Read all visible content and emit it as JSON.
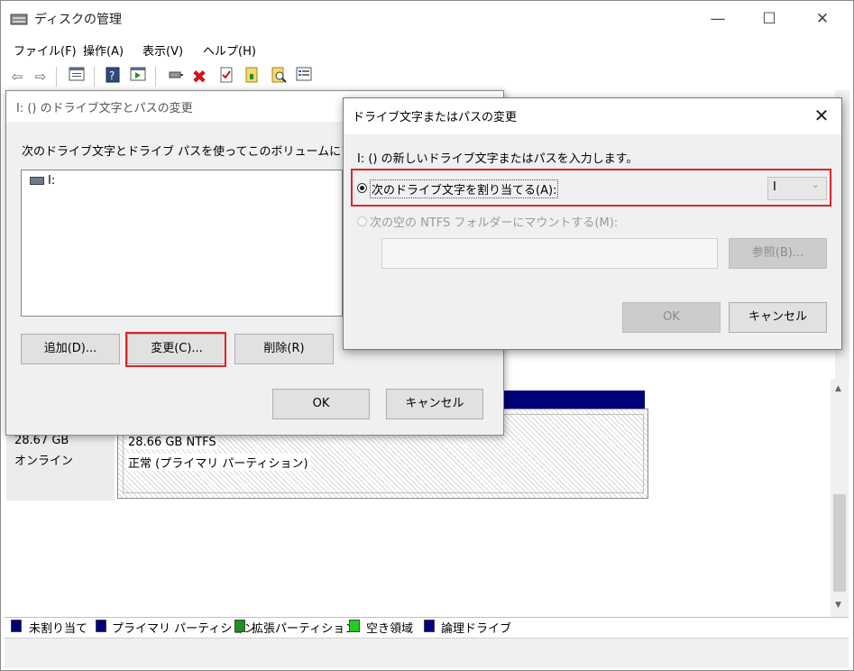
{
  "app": {
    "title": "ディスクの管理",
    "controls": {
      "minimize": "—",
      "maximize": "☐",
      "close": "✕"
    }
  },
  "menu": [
    "ファイル(F)",
    "操作(A)",
    "表示(V)",
    "ヘルプ(H)"
  ],
  "toolbar_icons": [
    "back-icon",
    "forward-icon",
    "properties-icon",
    "help-icon",
    "view-icon",
    "connect-icon",
    "delete-icon",
    "check-icon",
    "new-volume-icon",
    "search-icon",
    "list-icon"
  ],
  "disk": {
    "size": "28.67 GB",
    "status": "オンライン",
    "partition_size": "28.66 GB NTFS",
    "partition_status": "正常 (プライマリ パーティション)"
  },
  "legend": [
    {
      "label": "未割り当て",
      "color": "#000070"
    },
    {
      "label": "プライマリ パーティション",
      "color": "#00007b"
    },
    {
      "label": "拡張パーティション",
      "color": "#1f8f1f"
    },
    {
      "label": "空き領域",
      "color": "#22cc22"
    },
    {
      "label": "論理ドライブ",
      "color": "#000080"
    }
  ],
  "dialog1": {
    "title": "I: () のドライブ文字とパスの変更",
    "instruction": "次のドライブ文字とドライブ パスを使ってこのボリュームにアクセスできます:",
    "items": [
      "I:"
    ],
    "buttons": {
      "add": "追加(D)...",
      "change": "変更(C)...",
      "delete": "削除(R)",
      "ok": "OK",
      "cancel": "キャンセル"
    }
  },
  "dialog2": {
    "title": "ドライブ文字またはパスの変更",
    "instruction": "I: () の新しいドライブ文字またはパスを入力します。",
    "option_assign": "次のドライブ文字を割り当てる(A):",
    "selected_letter": "I",
    "option_mount": "次の空の NTFS フォルダーにマウントする(M):",
    "folder_path": "",
    "buttons": {
      "browse": "参照(B)...",
      "ok": "OK",
      "cancel": "キャンセル"
    },
    "close": "✕"
  },
  "highlight_color": "#e0242b"
}
